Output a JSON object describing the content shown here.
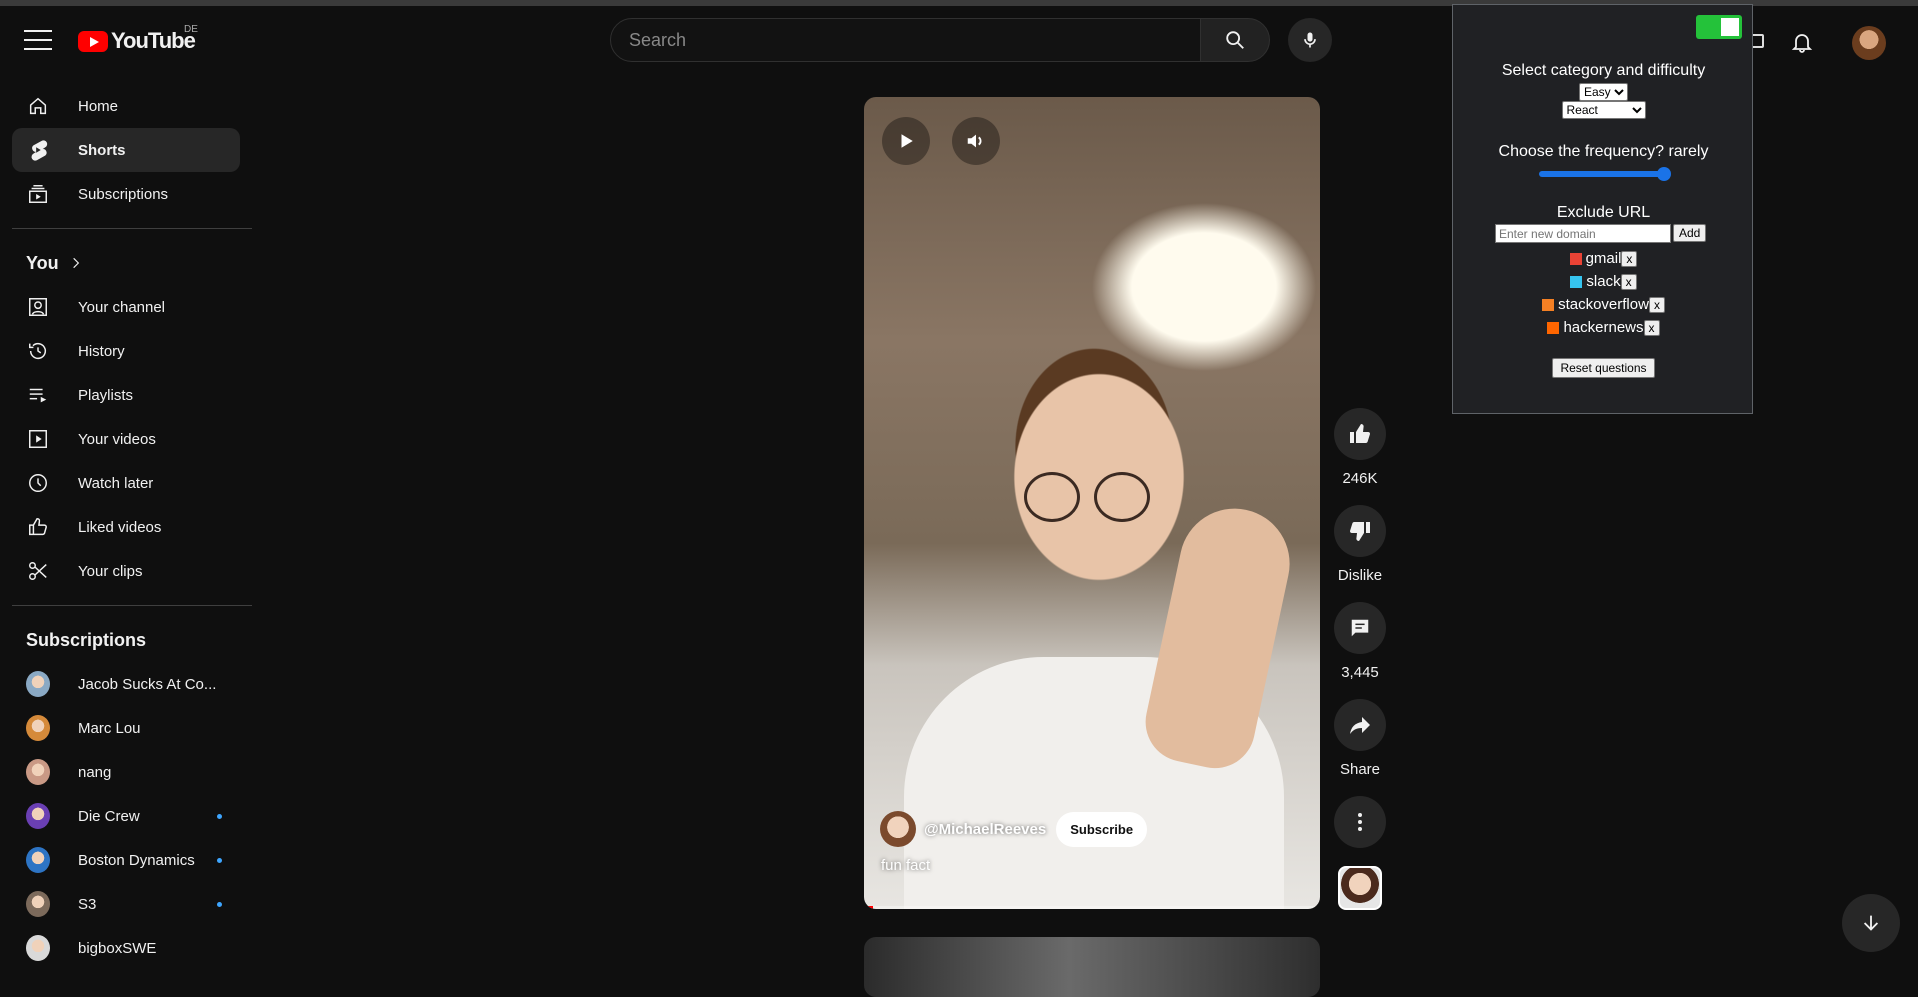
{
  "header": {
    "logo_text": "YouTube",
    "region": "DE",
    "search_placeholder": "Search"
  },
  "sidebar": {
    "main": [
      {
        "label": "Home",
        "icon": "home-icon"
      },
      {
        "label": "Shorts",
        "icon": "shorts-icon",
        "active": true
      },
      {
        "label": "Subscriptions",
        "icon": "subscriptions-icon"
      }
    ],
    "you_title": "You",
    "you_items": [
      {
        "label": "Your channel",
        "icon": "account-icon"
      },
      {
        "label": "History",
        "icon": "history-icon"
      },
      {
        "label": "Playlists",
        "icon": "playlists-icon"
      },
      {
        "label": "Your videos",
        "icon": "video-icon"
      },
      {
        "label": "Watch later",
        "icon": "clock-icon"
      },
      {
        "label": "Liked videos",
        "icon": "thumb-up-icon"
      },
      {
        "label": "Your clips",
        "icon": "scissors-icon"
      }
    ],
    "subscriptions_title": "Subscriptions",
    "subscriptions": [
      {
        "label": "Jacob Sucks At Co...",
        "new": false,
        "color": "#8aa9c4"
      },
      {
        "label": "Marc Lou",
        "new": false,
        "color": "#d58a3a"
      },
      {
        "label": "nang",
        "new": false,
        "color": "#c99985"
      },
      {
        "label": "Die Crew",
        "new": true,
        "color": "#6a3fb3"
      },
      {
        "label": "Boston Dynamics",
        "new": true,
        "color": "#2d74c4"
      },
      {
        "label": "S3",
        "new": true,
        "color": "#7c6a5b"
      },
      {
        "label": "bigboxSWE",
        "new": false,
        "color": "#d9d9d9"
      }
    ]
  },
  "short": {
    "channel": "@MichaelReeves",
    "subscribe_label": "Subscribe",
    "caption": "fun fact",
    "progress": 0.02
  },
  "actions": {
    "like_count": "246K",
    "dislike_label": "Dislike",
    "comment_count": "3,445",
    "share_label": "Share"
  },
  "extension": {
    "category_title": "Select category and difficulty",
    "difficulty": "Easy",
    "category": "React",
    "frequency_title": "Choose the frequency? rarely",
    "frequency_value": 1.0,
    "exclude_title": "Exclude URL",
    "domain_placeholder": "Enter new domain",
    "add_label": "Add",
    "remove_label": "x",
    "excluded": [
      {
        "name": "gmail",
        "icon": "gmail-icon"
      },
      {
        "name": "slack",
        "icon": "slack-icon"
      },
      {
        "name": "stackoverflow",
        "icon": "stackoverflow-icon"
      },
      {
        "name": "hackernews",
        "icon": "hackernews-icon"
      }
    ],
    "reset_label": "Reset questions",
    "toggle_on": true,
    "accent_color": "#24c23a"
  }
}
